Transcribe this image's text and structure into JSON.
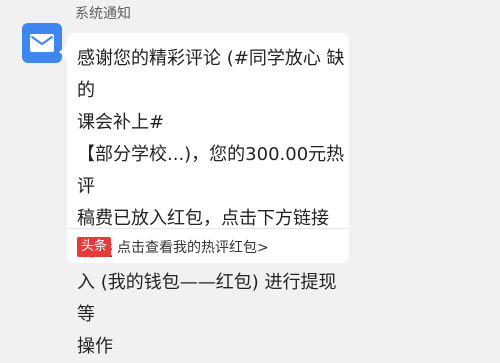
{
  "notification": {
    "sender": "系统通知",
    "icon": "mail-icon",
    "message": "感谢您的精彩评论 (#同学放心 缺的\n课会补上#\n【部分学校...)，您的300.00元热评\n稿费已放入红包，点击下方链接或进\n入 (我的钱包——红包) 进行提现等\n操作",
    "link": {
      "badge": "头条",
      "label": "点击查看我的热评红包>"
    }
  },
  "colors": {
    "avatar": "#3f86f0",
    "badge": "#e43b3b",
    "background": "#f1f1f1",
    "bubble": "#ffffff"
  }
}
